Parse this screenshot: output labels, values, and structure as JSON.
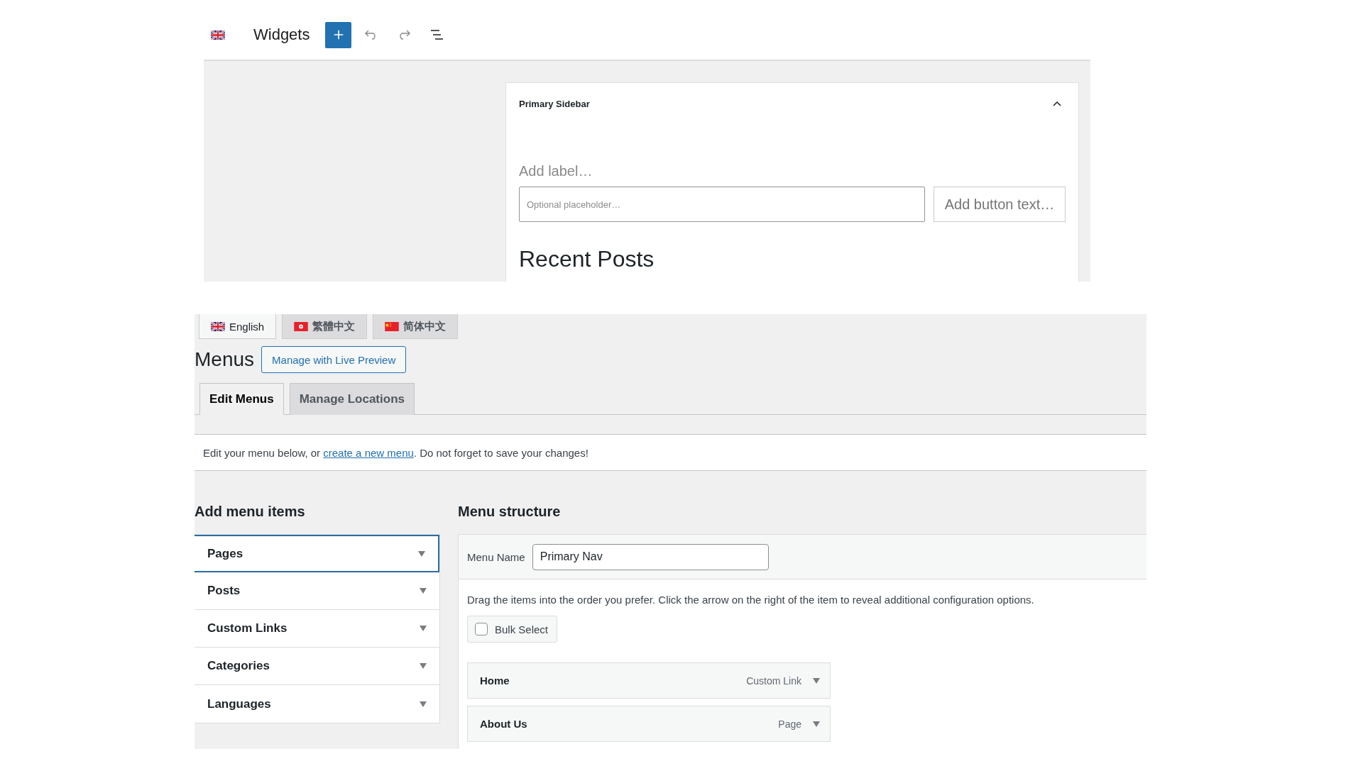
{
  "widgets_editor": {
    "language": {
      "kind": "uk"
    },
    "title": "Widgets",
    "widget_area": {
      "title": "Primary Sidebar",
      "expanded": true,
      "search_block": {
        "label": {
          "placeholder": "Add label…"
        },
        "input": {
          "placeholder": "Optional placeholder…"
        },
        "button": {
          "placeholder": "Add button text…"
        }
      },
      "heading": "Recent Posts"
    }
  },
  "menus_screen": {
    "language_tabs": [
      {
        "label": "English",
        "kind": "uk",
        "selected": true
      },
      {
        "label": "繁體中文",
        "kind": "hk",
        "selected": false
      },
      {
        "label": "简体中文",
        "kind": "cn",
        "selected": false
      }
    ],
    "title": "Menus",
    "live_preview_button": "Manage with Live Preview",
    "tabs": [
      {
        "label": "Edit Menus",
        "selected": true
      },
      {
        "label": "Manage Locations",
        "selected": false
      }
    ],
    "notice": {
      "before": "Edit your menu below, or ",
      "link": "create a new menu",
      "after": ". Do not forget to save your changes!"
    },
    "add_menu_items": {
      "title": "Add menu items",
      "sections": [
        {
          "label": "Pages",
          "selected": true
        },
        {
          "label": "Posts",
          "selected": false
        },
        {
          "label": "Custom Links",
          "selected": false
        },
        {
          "label": "Categories",
          "selected": false
        },
        {
          "label": "Languages",
          "selected": false
        }
      ]
    },
    "menu_structure": {
      "title": "Menu structure",
      "menu_name_label": "Menu Name",
      "menu_name_value": "Primary Nav",
      "instructions": "Drag the items into the order you prefer. Click the arrow on the right of the item to reveal additional configuration options.",
      "bulk_select": {
        "label": "Bulk Select",
        "checked": false
      },
      "items": [
        {
          "title": "Home",
          "type": "Custom Link"
        },
        {
          "title": "About Us",
          "type": "Page"
        }
      ]
    }
  }
}
